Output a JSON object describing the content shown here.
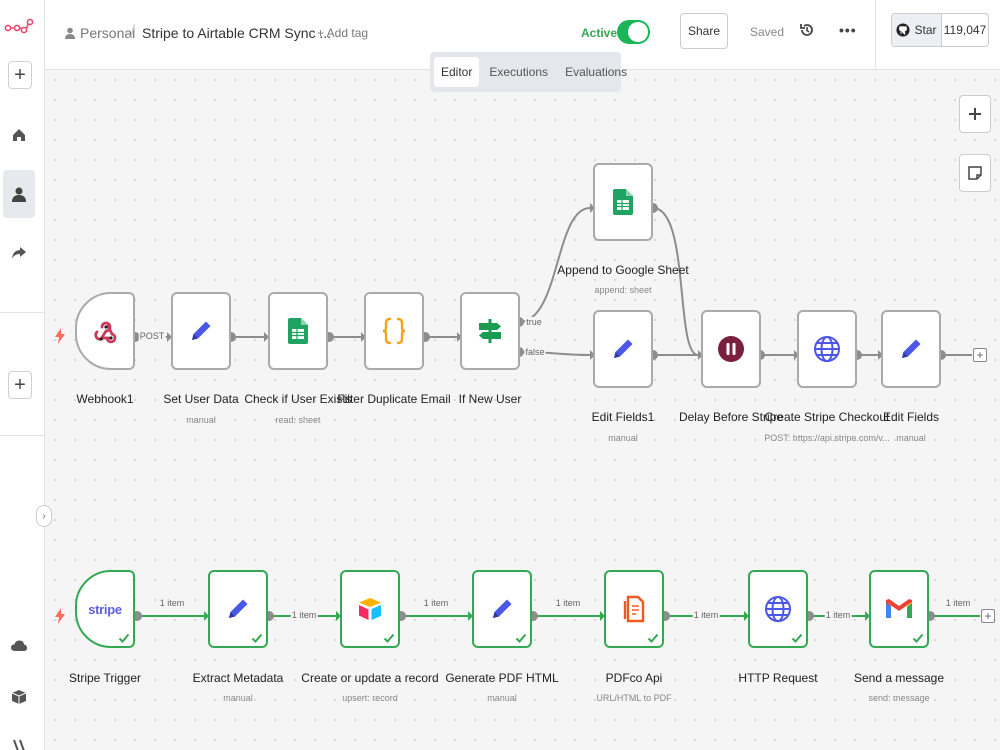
{
  "header": {
    "workspace": "Personal",
    "separator": "/",
    "workflow_title": "Stripe to Airtable CRM Sync ...",
    "add_tag": "+ Add tag",
    "active_label": "Active",
    "active": true,
    "share_label": "Share",
    "saved_label": "Saved",
    "github_star_label": "Star",
    "github_star_count": "119,047"
  },
  "tabs": [
    {
      "label": "Editor",
      "active": true
    },
    {
      "label": "Executions",
      "active": false
    },
    {
      "label": "Evaluations",
      "active": false
    }
  ],
  "nodes": {
    "webhook1": {
      "label": "Webhook1",
      "sub": "",
      "icon": "webhook-icon"
    },
    "set_user_data": {
      "label": "Set User Data",
      "sub": "manual",
      "icon": "pencil-icon"
    },
    "check_user": {
      "label": "Check if User Exists",
      "sub": "read: sheet",
      "icon": "google-sheets-icon"
    },
    "filter_dup": {
      "label": "Filter Duplicate Email",
      "sub": "",
      "icon": "code-braces-icon"
    },
    "if_new_user": {
      "label": "If New User",
      "sub": "",
      "icon": "branch-sign-icon"
    },
    "append_sheet": {
      "label": "Append to Google Sheet",
      "sub": "append: sheet",
      "icon": "google-sheets-icon"
    },
    "edit_fields1": {
      "label": "Edit Fields1",
      "sub": "manual",
      "icon": "pencil-icon"
    },
    "delay_stripe": {
      "label": "Delay Before Stripe",
      "sub": "",
      "icon": "pause-icon"
    },
    "create_checkout": {
      "label": "Create Stripe Checkout",
      "sub": "POST: https://api.stripe.com/v...",
      "icon": "globe-icon"
    },
    "edit_fields": {
      "label": "Edit Fields",
      "sub": "manual",
      "icon": "pencil-icon"
    },
    "stripe_trigger": {
      "label": "Stripe Trigger",
      "sub": "",
      "icon": "stripe-logo",
      "logo_text": "stripe"
    },
    "extract_meta": {
      "label": "Extract Metadata",
      "sub": "manual",
      "icon": "pencil-icon"
    },
    "airtable": {
      "label": "Create or update a record",
      "sub": "upsert: record",
      "icon": "airtable-icon"
    },
    "pdf_html": {
      "label": "Generate PDF HTML",
      "sub": "manual",
      "icon": "pencil-icon"
    },
    "pdfco": {
      "label": "PDFco Api",
      "sub": "URL/HTML to PDF",
      "icon": "pdfco-icon"
    },
    "http_request": {
      "label": "HTTP Request",
      "sub": "",
      "icon": "globe-icon"
    },
    "send_message": {
      "label": "Send a message",
      "sub": "send: message",
      "icon": "gmail-icon"
    }
  },
  "edges": {
    "webhook_method": "POST",
    "if_true": "true",
    "if_false": "false",
    "item_count": "1 item"
  },
  "colors": {
    "accent": "#ea4b71",
    "active_green": "#1ab559",
    "success": "#34a853",
    "pencil": "#4b57e6",
    "sheets": "#1ea362",
    "code": "#f7a21b",
    "branch": "#1a9c52",
    "pause": "#7a1f3d",
    "globe": "#4b57e6"
  }
}
